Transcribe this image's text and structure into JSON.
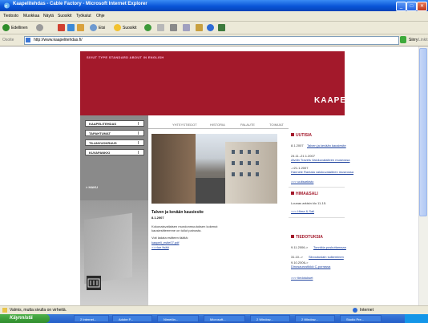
{
  "window": {
    "title": "Kaapelitehdas - Cable Factory - Microsoft Internet Explorer",
    "min": "_",
    "max": "□",
    "close": "✕"
  },
  "menu": [
    "Tiedosto",
    "Muokkaa",
    "Näytä",
    "Suosikit",
    "Työkalut",
    "Ohje"
  ],
  "toolbar": {
    "back": "Edellinen",
    "search": "Etsi",
    "favorites": "Suosikit"
  },
  "address": {
    "label": "Osoite",
    "url": "http://www.kaapelitehdas.fi/",
    "go": "Siirry",
    "links": "Linkit"
  },
  "site": {
    "top_links": "SIVUT TYPE STANDARD ABOUT IN ENGLISH",
    "logo": "KAAPELI",
    "nav": [
      "KAAPELITEHDAS",
      "TAPAHTUMAT",
      "TILANVUOKRAUS",
      "KUVAPANKKI"
    ],
    "search": "> HAKU",
    "tabs": [
      "YHTEYSTIEDOT",
      "HISTORIA",
      "PALAUTE",
      "TOIMIJAT"
    ],
    "news": {
      "title": "Talven ja kevään kausiesite",
      "date": "8.1.2007",
      "body1": "Kokonaisvaltaisen mundonmuutoksen kokenut",
      "body2": "kausiesitteemme on tullut painosta.",
      "body3": "Voit ladata esitteen täältä:",
      "link1": "kaapeli_esite07.pdf",
      "link2": ">>>lue lisää"
    },
    "right": {
      "uutisia": "UUTISIA",
      "u1": "8.1.2007",
      "u1_link": "Talven ja kevään kausiesite",
      "u2": "24.11.-21.1.2007",
      "u2_link": "Alvdin Travels Valokuvataiteen museossa",
      "u3": "->21.1.2007",
      "u3_link": "Hannele Rantala valokuvataiteen museossa",
      "u_more": ">>> uutisarkisto",
      "hima": "HIMA&SALI",
      "hima_text": "Lounas arkisin klo 11-15.",
      "hima_link": ">>> Hima & Sali",
      "tied": "TIEDOTUKSIA",
      "t1": "9.11.2006->",
      "t1_link": "Tonnikia puskuttamaan",
      "t2": "31.10.->",
      "t2_link": "Siivoutuslain sulkeminen",
      "t3": "9.10.2006->",
      "t3_link": "Dinosaurustikkä C-porrassa",
      "t_more": ">>> tiedotukset"
    }
  },
  "status": {
    "text": "Valmis, mutta sivulla on virheitä.",
    "zone": "Internet"
  },
  "taskbar": {
    "start": "Käynnistä",
    "tasks": [
      "2 Internet...",
      "Adobe P...",
      "Nimetön...",
      "Microsoft...",
      "2 Window...",
      "2 Window...",
      "Studio Pre..."
    ]
  }
}
